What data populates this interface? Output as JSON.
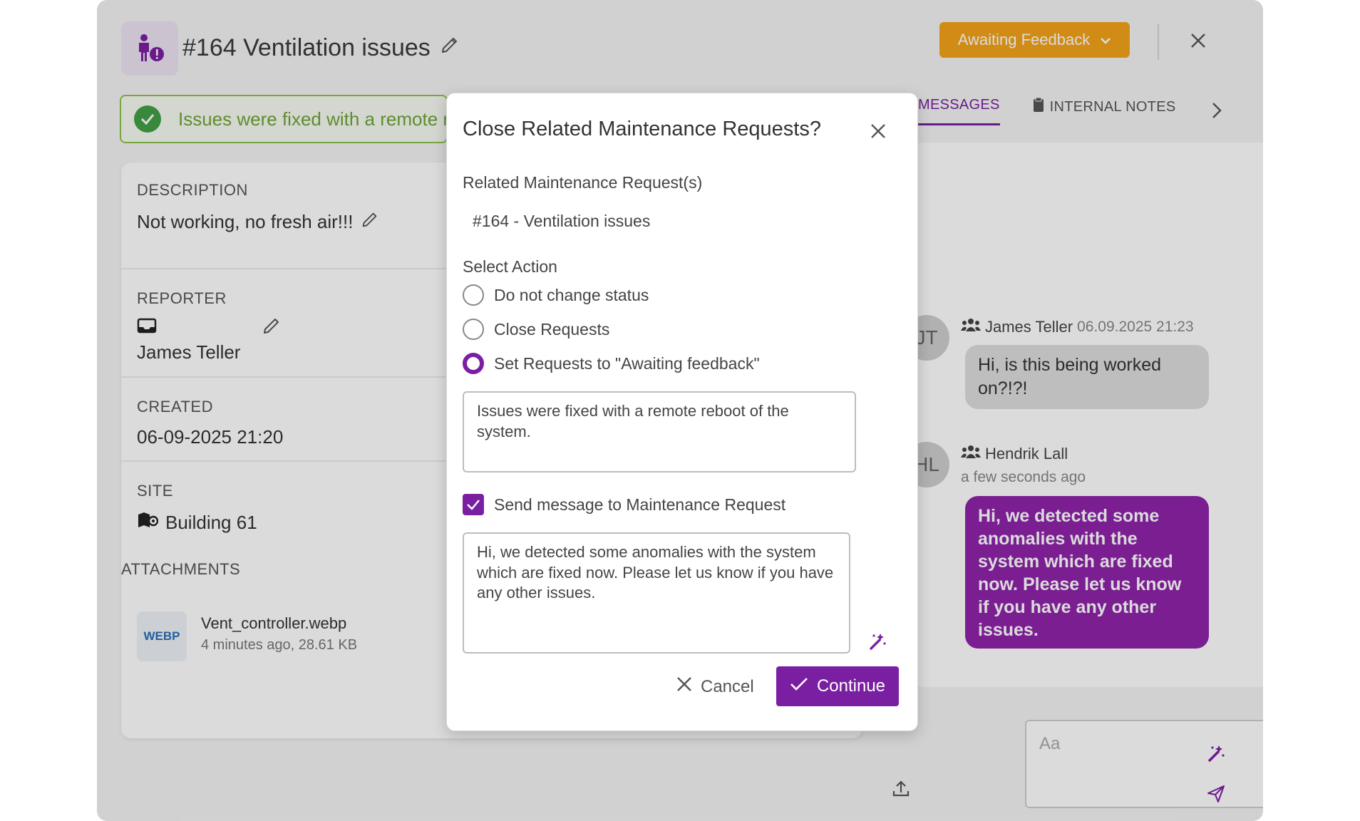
{
  "header": {
    "title": "#164 Ventilation issues",
    "status_label": "Awaiting Feedback"
  },
  "banner": {
    "text": "Issues were fixed with a remote reboot of the system."
  },
  "details": {
    "description_label": "DESCRIPTION",
    "description_value": "Not working, no fresh air!!!",
    "reporter_label": "REPORTER",
    "reporter_value": "James Teller",
    "created_label": "CREATED",
    "created_value": "06-09-2025 21:20",
    "site_label": "SITE",
    "site_value": "Building 61"
  },
  "attachments": {
    "label": "ATTACHMENTS",
    "items": [
      {
        "badge": "WEBP",
        "name": "Vent_controller.webp",
        "meta": "4 minutes ago, 28.61 KB"
      }
    ]
  },
  "tabs": {
    "messages": "MESSAGES",
    "internal_notes": "INTERNAL NOTES"
  },
  "chat": {
    "messages": [
      {
        "initials": "JT",
        "author": "James Teller",
        "time": "06.09.2025 21:23",
        "text": "Hi, is this being worked on?!?!"
      },
      {
        "initials": "HL",
        "author": "Hendrik Lall",
        "time": "a few seconds ago",
        "text": "Hi, we detected some anomalies with the system which are fixed now. Please let us know if you have any other issues."
      }
    ],
    "input_placeholder": "Aa"
  },
  "dialog": {
    "title": "Close Related Maintenance Requests?",
    "related_label": "Related Maintenance Request(s)",
    "related_value": "#164 - Ventilation issues",
    "select_action_label": "Select Action",
    "options": [
      "Do not change status",
      "Close Requests",
      "Set Requests to \"Awaiting feedback\""
    ],
    "selected_option": 2,
    "note_text": "Issues were fixed with a remote reboot of the system.",
    "send_message_label": "Send message to Maintenance Request",
    "send_message_checked": true,
    "message_text": "Hi, we detected some anomalies with the system which are fixed now. Please let us know if you have any other issues.",
    "cancel_label": "Cancel",
    "continue_label": "Continue"
  },
  "colors": {
    "accent": "#7b1fa2",
    "status": "#f4a31a",
    "success": "#43a047"
  }
}
